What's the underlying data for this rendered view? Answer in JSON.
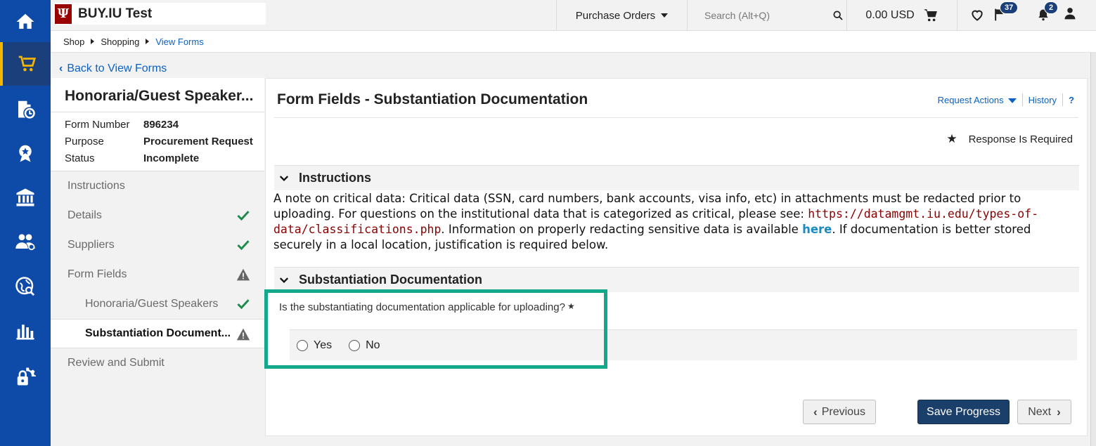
{
  "app": {
    "brand_name": "BUY.IU Test",
    "brand_logo_letter": "Ψ"
  },
  "rail": {
    "items": [
      {
        "name": "home-icon"
      },
      {
        "name": "cart-icon",
        "active": true
      },
      {
        "name": "orders-clock-icon"
      },
      {
        "name": "award-icon"
      },
      {
        "name": "bank-icon"
      },
      {
        "name": "users-icon"
      },
      {
        "name": "globe-search-icon"
      },
      {
        "name": "bar-chart-icon"
      },
      {
        "name": "settings-lock-icon"
      }
    ]
  },
  "topbar": {
    "purchase_orders": "Purchase Orders",
    "search_placeholder": "Search (Alt+Q)",
    "cart_total": "0.00 USD",
    "flag_badge": "37",
    "bell_badge": "2"
  },
  "breadcrumb": {
    "items": [
      "Shop",
      "Shopping",
      "View Forms"
    ]
  },
  "back_link": "Back to View Forms",
  "form": {
    "title": "Honoraria/Guest Speaker...",
    "meta": [
      {
        "key": "Form Number",
        "value": "896234"
      },
      {
        "key": "Purpose",
        "value": "Procurement Request"
      },
      {
        "key": "Status",
        "value": "Incomplete"
      }
    ]
  },
  "nav": {
    "items": [
      {
        "label": "Instructions",
        "status": "none"
      },
      {
        "label": "Details",
        "status": "complete"
      },
      {
        "label": "Suppliers",
        "status": "complete"
      },
      {
        "label": "Form Fields",
        "status": "warning"
      },
      {
        "label": "Honoraria/Guest Speakers",
        "status": "complete",
        "sub": true
      },
      {
        "label": "Substantiation Document...",
        "status": "warning",
        "sub": true,
        "active": true
      },
      {
        "label": "Review and Submit",
        "status": "none"
      }
    ]
  },
  "main": {
    "title": "Form Fields - Substantiation Documentation",
    "request_actions": "Request Actions",
    "history": "History",
    "help": "?",
    "required_star": "★",
    "required_label": "Response Is Required",
    "instructions_header": "Instructions",
    "instructions_text_1": "A note on critical data:  Critical data (SSN, card numbers, bank accounts, visa info, etc) in attachments must be redacted prior to uploading.  For questions on the institutional data that is categorized as critical, please see: ",
    "instructions_link_1": "https://datamgmt.iu.edu/types-of-data/classifications.php",
    "instructions_text_2": ".  Information on properly redacting sensitive data is available ",
    "instructions_link_2": "here",
    "instructions_text_3": ".  If documentation is better stored securely in a local location, justification is required below.",
    "substantiation_header": "Substantiation Documentation",
    "question": "Is the substantiating documentation applicable for uploading?",
    "question_star": "★",
    "option_yes": "Yes",
    "option_no": "No",
    "previous": "Previous",
    "save_progress": "Save Progress",
    "next": "Next"
  },
  "colors": {
    "rail_bg": "#0e4aa8",
    "accent_yellow": "#f4b400",
    "link_blue": "#0b62c4",
    "highlight_teal": "#14a88a",
    "save_button": "#1b3f6b",
    "check_green": "#1e8a4c"
  }
}
